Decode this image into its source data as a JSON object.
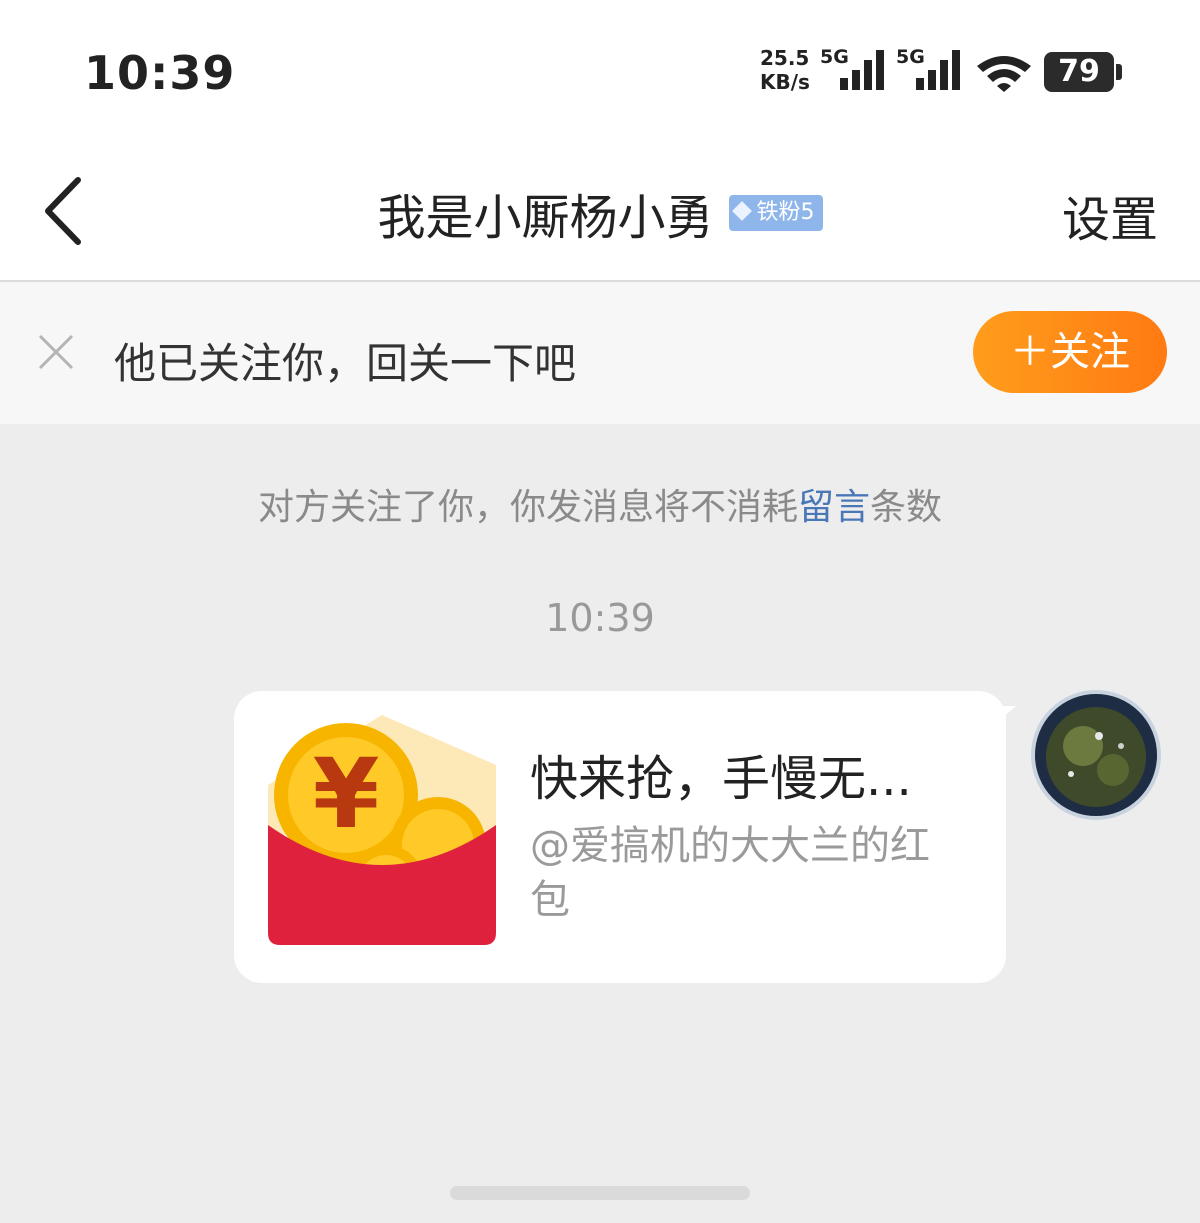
{
  "status_bar": {
    "time": "10:39",
    "net_speed_value": "25.5",
    "net_speed_unit": "KB/s",
    "signal1_label": "5G",
    "signal2_label": "5G",
    "battery": "79",
    "icons": [
      "signal-icon",
      "signal-icon",
      "wifi-icon",
      "battery-icon"
    ]
  },
  "header": {
    "title": "我是小厮杨小勇",
    "badge": "铁粉5",
    "settings": "设置"
  },
  "follow_bar": {
    "text": "他已关注你，回关一下吧",
    "button": "＋关注"
  },
  "chat": {
    "system_note_before": "对方关注了你，你发消息将不消耗",
    "system_note_link": "留言",
    "system_note_after": "条数",
    "timestamp": "10:39",
    "message": {
      "title": "快来抢，手慢无...",
      "subtitle": "@爱搞机的大大兰的红包"
    }
  },
  "colors": {
    "accent_orange": "#ff8a16",
    "link_blue": "#4a78b7",
    "badge_blue": "#8fb6ea",
    "envelope_red": "#e0213e",
    "coin_gold": "#f7b500"
  }
}
